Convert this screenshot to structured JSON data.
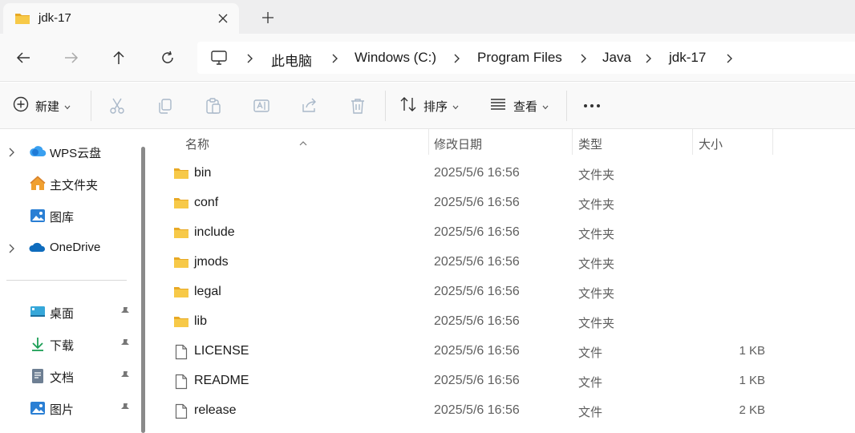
{
  "tab": {
    "title": "jdk-17"
  },
  "breadcrumb": [
    "此电脑",
    "Windows (C:)",
    "Program Files",
    "Java",
    "jdk-17"
  ],
  "toolbar": {
    "new_label": "新建",
    "sort_label": "排序",
    "view_label": "查看"
  },
  "sidebar": {
    "items": [
      {
        "label": "WPS云盘",
        "icon": "cloud-icon"
      },
      {
        "label": "主文件夹",
        "icon": "home-icon"
      },
      {
        "label": "图库",
        "icon": "gallery-icon"
      },
      {
        "label": "OneDrive",
        "icon": "onedrive-icon"
      }
    ],
    "pinned": [
      {
        "label": "桌面",
        "icon": "desktop-icon"
      },
      {
        "label": "下载",
        "icon": "download-icon"
      },
      {
        "label": "文档",
        "icon": "document-icon"
      },
      {
        "label": "图片",
        "icon": "picture-icon"
      }
    ]
  },
  "columns": {
    "name": "名称",
    "modified": "修改日期",
    "type": "类型",
    "size": "大小"
  },
  "files": [
    {
      "name": "bin",
      "modified": "2025/5/6 16:56",
      "type": "文件夹",
      "size": "",
      "kind": "folder"
    },
    {
      "name": "conf",
      "modified": "2025/5/6 16:56",
      "type": "文件夹",
      "size": "",
      "kind": "folder"
    },
    {
      "name": "include",
      "modified": "2025/5/6 16:56",
      "type": "文件夹",
      "size": "",
      "kind": "folder"
    },
    {
      "name": "jmods",
      "modified": "2025/5/6 16:56",
      "type": "文件夹",
      "size": "",
      "kind": "folder"
    },
    {
      "name": "legal",
      "modified": "2025/5/6 16:56",
      "type": "文件夹",
      "size": "",
      "kind": "folder"
    },
    {
      "name": "lib",
      "modified": "2025/5/6 16:56",
      "type": "文件夹",
      "size": "",
      "kind": "folder"
    },
    {
      "name": "LICENSE",
      "modified": "2025/5/6 16:56",
      "type": "文件",
      "size": "1 KB",
      "kind": "file"
    },
    {
      "name": "README",
      "modified": "2025/5/6 16:56",
      "type": "文件",
      "size": "1 KB",
      "kind": "file"
    },
    {
      "name": "release",
      "modified": "2025/5/6 16:56",
      "type": "文件",
      "size": "2 KB",
      "kind": "file"
    }
  ],
  "colors": {
    "folder": "#f7c948",
    "folder_dark": "#e8a925",
    "accent": "#0067c0"
  }
}
